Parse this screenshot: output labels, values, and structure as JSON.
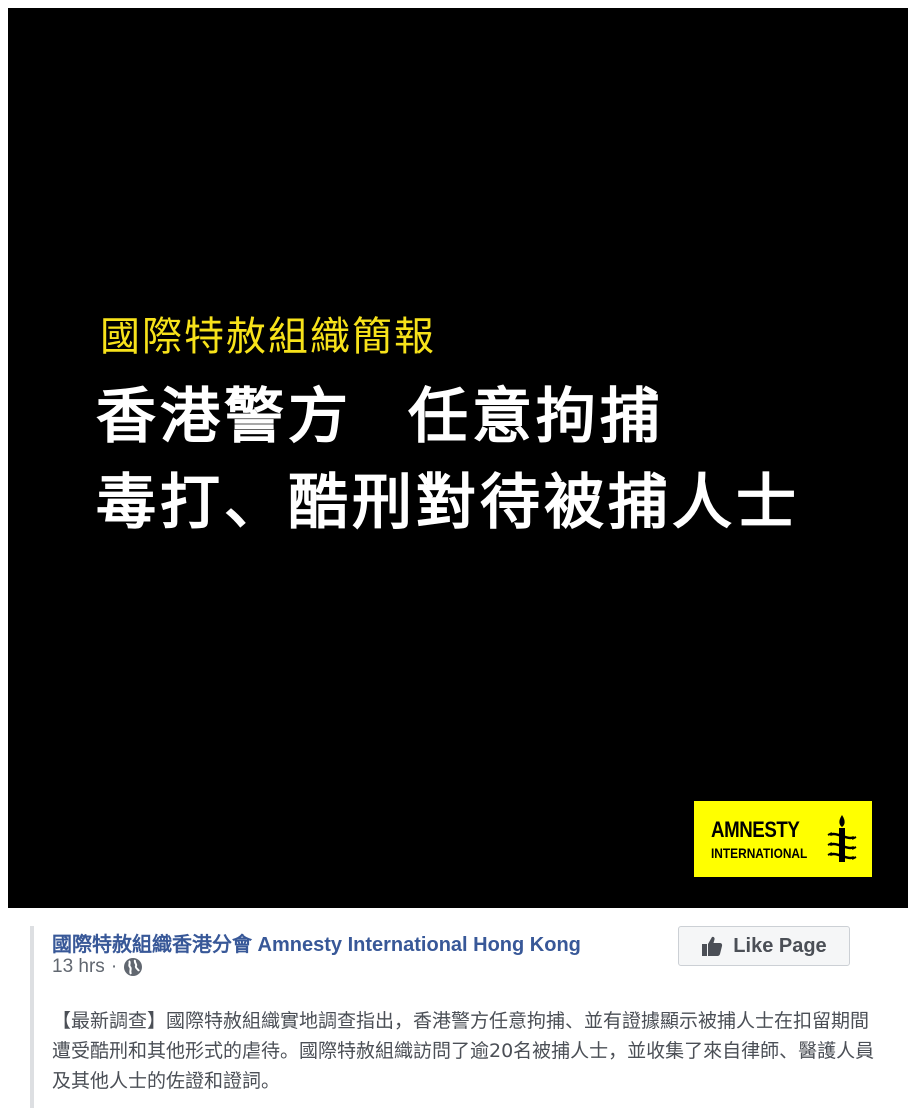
{
  "media": {
    "subtitle": "國際特赦組織簡報",
    "headline_line1_part1": "香港警方",
    "headline_line1_part2": "任意拘捕",
    "headline_line2": "毒打、酷刑對待被捕人士",
    "logo": {
      "word1": "AMNESTY",
      "word2": "INTERNATIONAL",
      "icon": "candle-barbed-wire-icon"
    },
    "colors": {
      "background": "#000000",
      "subtitle": "#f7e21a",
      "headline": "#ffffff",
      "logo_bg": "#ffff00"
    }
  },
  "post": {
    "page_name": "國際特赦組織香港分會 Amnesty International Hong Kong",
    "timestamp": "13 hrs",
    "separator": "·",
    "privacy_icon": "globe-icon",
    "like_button_label": "Like Page",
    "like_button_icon": "thumbs-up-icon",
    "text": "【最新調查】國際特赦組織實地調查指出，香港警方任意拘捕、並有證據顯示被捕人士在扣留期間遭受酷刑和其他形式的虐待。國際特赦組織訪問了逾20名被捕人士，並收集了來自律師、醫護人員及其他人士的佐證和證詞。",
    "colors": {
      "link": "#385898",
      "meta": "#616770",
      "body": "#4b4f56"
    }
  }
}
